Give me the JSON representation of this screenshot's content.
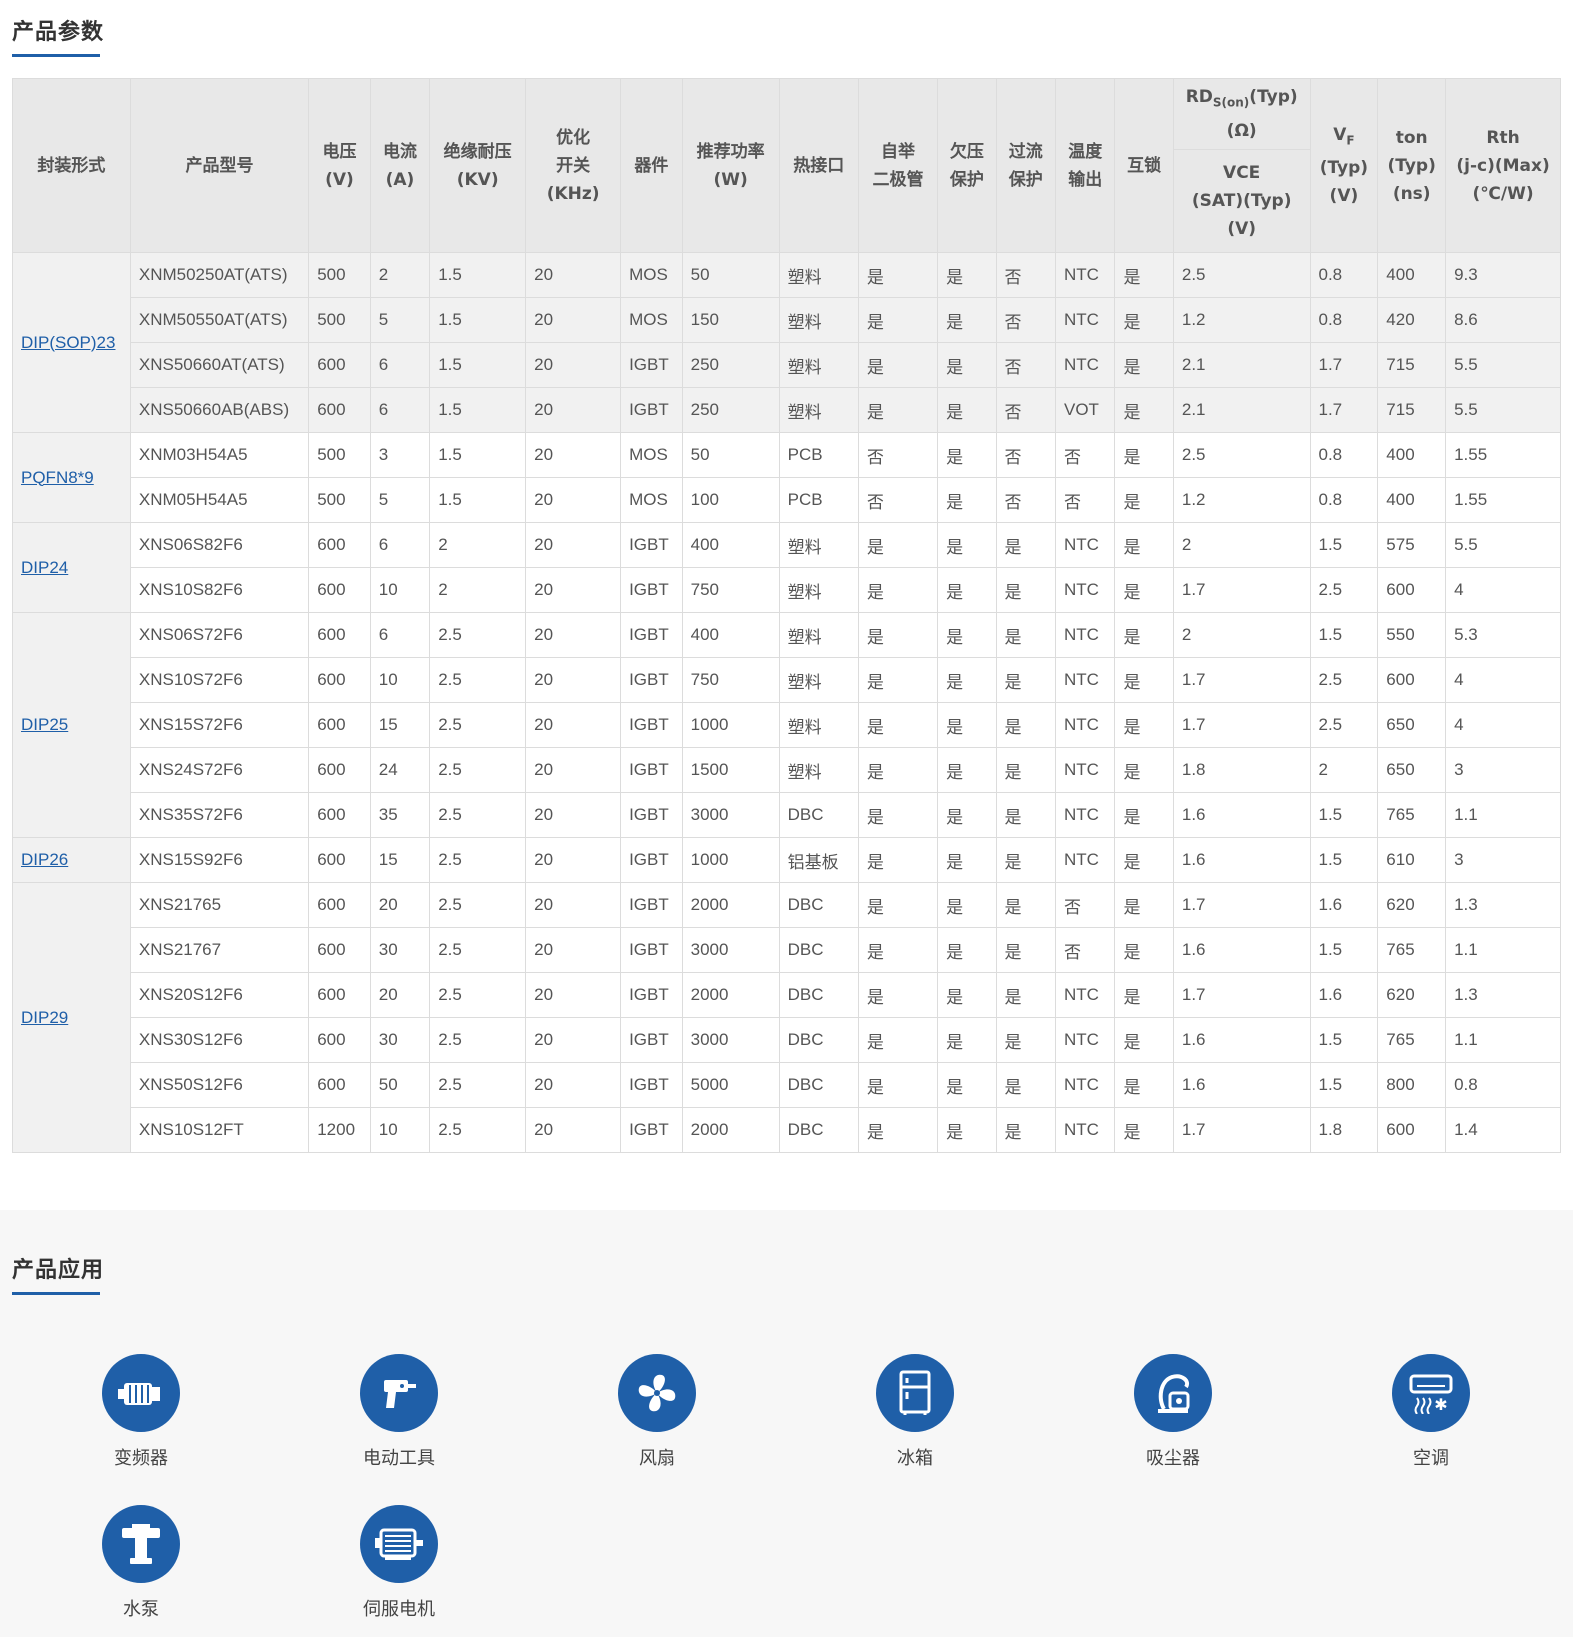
{
  "sections": {
    "params_title": "产品参数",
    "apps_title": "产品应用"
  },
  "table": {
    "headers": {
      "pkg": "封装形式",
      "model": "产品型号",
      "voltage_1": "电压",
      "voltage_2": "(V)",
      "current_1": "电流",
      "current_2": "(A)",
      "insulation_1": "绝缘耐压",
      "insulation_2": "(KV)",
      "switch_1": "优化",
      "switch_2": "开关",
      "switch_3": "(KHz)",
      "device": "器件",
      "power_1": "推荐功率",
      "power_2": "(W)",
      "thermal": "热接口",
      "bootstrap_1": "自举",
      "bootstrap_2": "二极管",
      "uv_1": "欠压",
      "uv_2": "保护",
      "oc_1": "过流",
      "oc_2": "保护",
      "temp_1": "温度",
      "temp_2": "输出",
      "interlock": "互锁",
      "rds_main": "RD",
      "rds_sub": "S(on)",
      "rds_typ": "(Typ)",
      "rds_unit": "(Ω)",
      "vce_1": "VCE",
      "vce_2": "(SAT)(Typ)",
      "vce_3": "(V)",
      "vf_main": "V",
      "vf_sub": "F",
      "vf_2": "(Typ)",
      "vf_3": "(V)",
      "ton_1": "ton",
      "ton_2": "(Typ)",
      "ton_3": "(ns)",
      "rth_1": "Rth",
      "rth_2": "(j-c)(Max)",
      "rth_3": "(℃/W)"
    },
    "groups": [
      {
        "package": "DIP(SOP)23",
        "rows": [
          [
            "XNM50250AT(ATS)",
            "500",
            "2",
            "1.5",
            "20",
            "MOS",
            "50",
            "塑料",
            "是",
            "是",
            "否",
            "NTC",
            "是",
            "2.5",
            "0.8",
            "400",
            "9.3"
          ],
          [
            "XNM50550AT(ATS)",
            "500",
            "5",
            "1.5",
            "20",
            "MOS",
            "150",
            "塑料",
            "是",
            "是",
            "否",
            "NTC",
            "是",
            "1.2",
            "0.8",
            "420",
            "8.6"
          ],
          [
            "XNS50660AT(ATS)",
            "600",
            "6",
            "1.5",
            "20",
            "IGBT",
            "250",
            "塑料",
            "是",
            "是",
            "否",
            "NTC",
            "是",
            "2.1",
            "1.7",
            "715",
            "5.5"
          ],
          [
            "XNS50660AB(ABS)",
            "600",
            "6",
            "1.5",
            "20",
            "IGBT",
            "250",
            "塑料",
            "是",
            "是",
            "否",
            "VOT",
            "是",
            "2.1",
            "1.7",
            "715",
            "5.5"
          ]
        ]
      },
      {
        "package": "PQFN8*9",
        "rows": [
          [
            "XNM03H54A5",
            "500",
            "3",
            "1.5",
            "20",
            "MOS",
            "50",
            "PCB",
            "否",
            "是",
            "否",
            "否",
            "是",
            "2.5",
            "0.8",
            "400",
            "1.55"
          ],
          [
            "XNM05H54A5",
            "500",
            "5",
            "1.5",
            "20",
            "MOS",
            "100",
            "PCB",
            "否",
            "是",
            "否",
            "否",
            "是",
            "1.2",
            "0.8",
            "400",
            "1.55"
          ]
        ]
      },
      {
        "package": "DIP24",
        "rows": [
          [
            "XNS06S82F6",
            "600",
            "6",
            "2",
            "20",
            "IGBT",
            "400",
            "塑料",
            "是",
            "是",
            "是",
            "NTC",
            "是",
            "2",
            "1.5",
            "575",
            "5.5"
          ],
          [
            "XNS10S82F6",
            "600",
            "10",
            "2",
            "20",
            "IGBT",
            "750",
            "塑料",
            "是",
            "是",
            "是",
            "NTC",
            "是",
            "1.7",
            "2.5",
            "600",
            "4"
          ]
        ]
      },
      {
        "package": "DIP25",
        "rows": [
          [
            "XNS06S72F6",
            "600",
            "6",
            "2.5",
            "20",
            "IGBT",
            "400",
            "塑料",
            "是",
            "是",
            "是",
            "NTC",
            "是",
            "2",
            "1.5",
            "550",
            "5.3"
          ],
          [
            "XNS10S72F6",
            "600",
            "10",
            "2.5",
            "20",
            "IGBT",
            "750",
            "塑料",
            "是",
            "是",
            "是",
            "NTC",
            "是",
            "1.7",
            "2.5",
            "600",
            "4"
          ],
          [
            "XNS15S72F6",
            "600",
            "15",
            "2.5",
            "20",
            "IGBT",
            "1000",
            "塑料",
            "是",
            "是",
            "是",
            "NTC",
            "是",
            "1.7",
            "2.5",
            "650",
            "4"
          ],
          [
            "XNS24S72F6",
            "600",
            "24",
            "2.5",
            "20",
            "IGBT",
            "1500",
            "塑料",
            "是",
            "是",
            "是",
            "NTC",
            "是",
            "1.8",
            "2",
            "650",
            "3"
          ],
          [
            "XNS35S72F6",
            "600",
            "35",
            "2.5",
            "20",
            "IGBT",
            "3000",
            "DBC",
            "是",
            "是",
            "是",
            "NTC",
            "是",
            "1.6",
            "1.5",
            "765",
            "1.1"
          ]
        ]
      },
      {
        "package": "DIP26",
        "rows": [
          [
            "XNS15S92F6",
            "600",
            "15",
            "2.5",
            "20",
            "IGBT",
            "1000",
            "铝基板",
            "是",
            "是",
            "是",
            "NTC",
            "是",
            "1.6",
            "1.5",
            "610",
            "3"
          ]
        ]
      },
      {
        "package": "DIP29",
        "rows": [
          [
            "XNS21765",
            "600",
            "20",
            "2.5",
            "20",
            "IGBT",
            "2000",
            "DBC",
            "是",
            "是",
            "是",
            "否",
            "是",
            "1.7",
            "1.6",
            "620",
            "1.3"
          ],
          [
            "XNS21767",
            "600",
            "30",
            "2.5",
            "20",
            "IGBT",
            "3000",
            "DBC",
            "是",
            "是",
            "是",
            "否",
            "是",
            "1.6",
            "1.5",
            "765",
            "1.1"
          ],
          [
            "XNS20S12F6",
            "600",
            "20",
            "2.5",
            "20",
            "IGBT",
            "2000",
            "DBC",
            "是",
            "是",
            "是",
            "NTC",
            "是",
            "1.7",
            "1.6",
            "620",
            "1.3"
          ],
          [
            "XNS30S12F6",
            "600",
            "30",
            "2.5",
            "20",
            "IGBT",
            "3000",
            "DBC",
            "是",
            "是",
            "是",
            "NTC",
            "是",
            "1.6",
            "1.5",
            "765",
            "1.1"
          ],
          [
            "XNS50S12F6",
            "600",
            "50",
            "2.5",
            "20",
            "IGBT",
            "5000",
            "DBC",
            "是",
            "是",
            "是",
            "NTC",
            "是",
            "1.6",
            "1.5",
            "800",
            "0.8"
          ],
          [
            "XNS10S12FT",
            "1200",
            "10",
            "2.5",
            "20",
            "IGBT",
            "2000",
            "DBC",
            "是",
            "是",
            "是",
            "NTC",
            "是",
            "1.7",
            "1.8",
            "600",
            "1.4"
          ]
        ]
      }
    ]
  },
  "applications": [
    {
      "label": "变频器",
      "icon": "inverter-icon"
    },
    {
      "label": "电动工具",
      "icon": "power-drill-icon"
    },
    {
      "label": "风扇",
      "icon": "fan-icon"
    },
    {
      "label": "冰箱",
      "icon": "fridge-icon"
    },
    {
      "label": "吸尘器",
      "icon": "vacuum-icon"
    },
    {
      "label": "空调",
      "icon": "air-conditioner-icon"
    },
    {
      "label": "水泵",
      "icon": "water-pump-icon"
    },
    {
      "label": "伺服电机",
      "icon": "servo-motor-icon"
    }
  ],
  "colors": {
    "accent": "#1f5fa8",
    "header_bg": "#e8e8e8",
    "group_bg": "#f1f1f1",
    "apps_bg": "#f7f7f7"
  }
}
